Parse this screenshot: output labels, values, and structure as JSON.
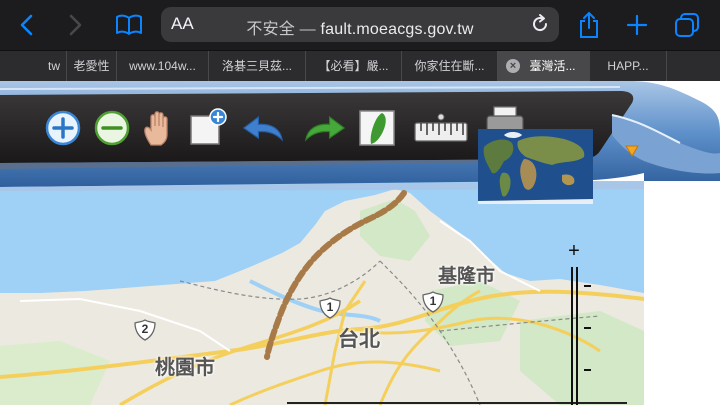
{
  "browser": {
    "aa_label": "AA",
    "url_prefix": "不安全 —",
    "url_domain": "fault.moeacgs.gov.tw"
  },
  "tabs": [
    {
      "label": "tw"
    },
    {
      "label": "老愛性"
    },
    {
      "label": "www.104w..."
    },
    {
      "label": "洛碁三貝茲..."
    },
    {
      "label": "【必看】嚴..."
    },
    {
      "label": "你家住在斷..."
    },
    {
      "label": "臺灣活...",
      "active": true
    },
    {
      "label": "HAPP..."
    }
  ],
  "toolbar": {
    "tools": [
      "zoom-in",
      "zoom-out",
      "pan-hand",
      "zoom-box",
      "previous-extent",
      "next-extent",
      "full-extent",
      "measure",
      "print"
    ]
  },
  "map": {
    "labels": {
      "keelung": "基隆市",
      "taipei": "台北",
      "taoyuan": "桃園市"
    },
    "route_badges": [
      "1",
      "1",
      "2"
    ],
    "zoom_plus": "+",
    "colors": {
      "land": "#eae6dc",
      "water": "#9fd0f5",
      "fault_line": "#a77a48",
      "highway": "#f8d363"
    }
  }
}
